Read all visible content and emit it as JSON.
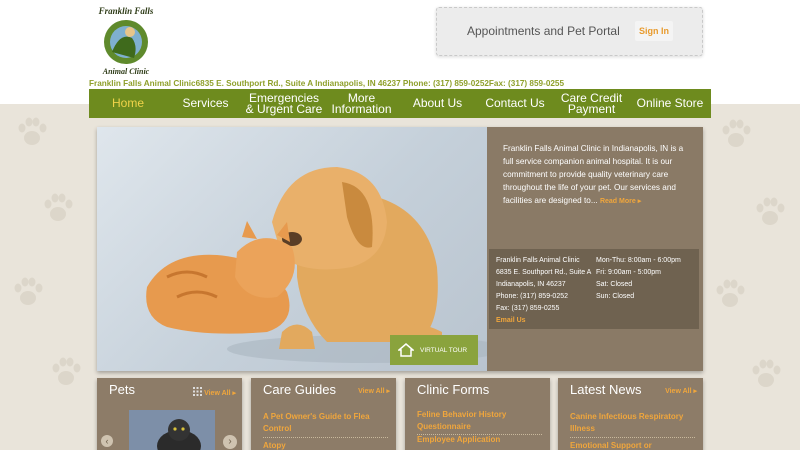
{
  "header": {
    "logo_text": "Franklin Falls Animal Clinic",
    "contact_line": "Franklin Falls Animal Clinic6835 E. Southport Rd., Suite A Indianapolis, IN 46237 Phone: (317) 859-0252Fax: (317) 859-0255"
  },
  "portal": {
    "title": "Appointments and Pet Portal",
    "sign_in": "Sign In"
  },
  "nav": {
    "items": [
      {
        "label": "Home"
      },
      {
        "label": "Services"
      },
      {
        "label": "Emergencies & Urgent Care"
      },
      {
        "label": "More Information"
      },
      {
        "label": "About Us"
      },
      {
        "label": "Contact Us"
      },
      {
        "label": "Care Credit Payment"
      },
      {
        "label": "Online Store"
      }
    ]
  },
  "hero": {
    "intro": "Franklin Falls Animal Clinic in Indianapolis, IN is a full service companion animal hospital. It is our commitment to provide quality veterinary care throughout the life of your pet. Our services and facilities are designed to...",
    "read_more": "Read More",
    "address": {
      "name": "Franklin Falls Animal Clinic",
      "street": "6835 E. Southport Rd., Suite A",
      "city": "Indianapolis, IN 46237",
      "phone": "Phone: (317) 859-0252",
      "fax": "Fax: (317) 859-0255",
      "email": "Email Us"
    },
    "hours": {
      "mon_thu": "Mon-Thu: 8:00am - 6:00pm",
      "fri": "Fri: 9:00am - 5:00pm",
      "sat": "Sat: Closed",
      "sun": "Sun: Closed"
    },
    "virtual_tour": "VIRTUAL TOUR"
  },
  "cards": {
    "pets": {
      "title": "Pets",
      "view_all": "View All"
    },
    "care_guides": {
      "title": "Care Guides",
      "view_all": "View All",
      "links": [
        "A Pet Owner's Guide to Flea Control",
        "Atopy"
      ]
    },
    "clinic_forms": {
      "title": "Clinic Forms",
      "links": [
        "Feline Behavior History Questionnaire",
        "Employee Application"
      ]
    },
    "latest_news": {
      "title": "Latest News",
      "view_all": "View All",
      "links": [
        "Canine Infectious Respiratory Illness",
        "Emotional Support or"
      ]
    }
  },
  "colors": {
    "nav_bg": "#6e8b1e",
    "accent": "#f0a63c",
    "card_bg": "#8d7c68"
  }
}
